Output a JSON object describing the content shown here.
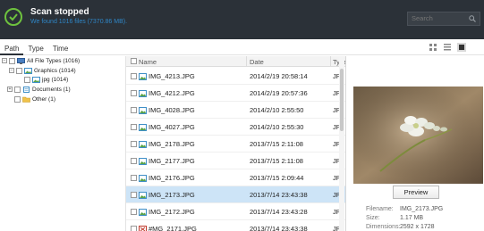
{
  "header": {
    "title": "Scan stopped",
    "subtitle": "We found 1016 files (7370.86 MB).",
    "search_placeholder": "Search"
  },
  "tabs": [
    {
      "label": "Path",
      "active": true
    },
    {
      "label": "Type",
      "active": false
    },
    {
      "label": "Time",
      "active": false
    }
  ],
  "tree": [
    {
      "label": "All File Types (1016)"
    },
    {
      "label": "Graphics (1014)"
    },
    {
      "label": "jpg (1014)"
    },
    {
      "label": "Documents (1)"
    },
    {
      "label": "Other (1)"
    }
  ],
  "list": {
    "columns": [
      "Name",
      "Date",
      "Type"
    ],
    "rows": [
      {
        "name": "IMG_4213.JPG",
        "date": "2014/2/19 20:58:14",
        "type": "JPI"
      },
      {
        "name": "IMG_4212.JPG",
        "date": "2014/2/19 20:57:36",
        "type": "JPI"
      },
      {
        "name": "IMG_4028.JPG",
        "date": "2014/2/10 2:55:50",
        "type": "JPI"
      },
      {
        "name": "IMG_4027.JPG",
        "date": "2014/2/10 2:55:30",
        "type": "JPI"
      },
      {
        "name": "IMG_2178.JPG",
        "date": "2013/7/15 2:11:08",
        "type": "JPI"
      },
      {
        "name": "IMG_2177.JPG",
        "date": "2013/7/15 2:11:08",
        "type": "JPI"
      },
      {
        "name": "IMG_2176.JPG",
        "date": "2013/7/15 2:09:44",
        "type": "JPI"
      },
      {
        "name": "IMG_2173.JPG",
        "date": "2013/7/14 23:43:38",
        "type": "JPI",
        "selected": true
      },
      {
        "name": "IMG_2172.JPG",
        "date": "2013/7/14 23:43:28",
        "type": "JPI"
      },
      {
        "name": "#MG_2171.JPG",
        "date": "2013/7/14 23:43:38",
        "type": "JPI",
        "damaged": true
      }
    ]
  },
  "preview": {
    "button_label": "Preview",
    "filename_label": "Filename:",
    "filename_value": "IMG_2173.JPG",
    "size_label": "Size:",
    "size_value": "1.17 MB",
    "dimensions_label": "Dimensions:",
    "dimensions_value": "2592 x 1728"
  },
  "colors": {
    "topbar_bg": "#2b3138",
    "success_green": "#6ec23e",
    "subtitle_blue": "#2f86c6",
    "selected_row": "#cde4f7"
  },
  "icons": {
    "status": "check-circle-icon",
    "search": "search-icon",
    "view_grid": "grid-view-icon",
    "view_list": "list-view-icon",
    "view_detail": "detail-view-icon"
  }
}
